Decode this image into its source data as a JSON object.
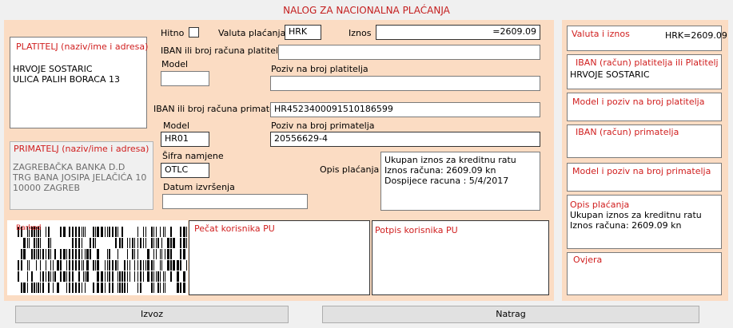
{
  "form_title": "NALOG ZA NACIONALNA PLAĆANJA",
  "platitelj": {
    "label": "PLATITELJ (naziv/ime i adresa)",
    "value": "HRVOJE SOSTARIC\nULICA PALIH BORACA 13"
  },
  "primatelj": {
    "label": "PRIMATELJ (naziv/ime i adresa)",
    "value": "ZAGREBAČKA BANKA D.D\nTRG BANA JOSIPA JELAČIĆA 10\n10000 ZAGREB"
  },
  "hitno_label": "Hitno",
  "hitno_checked": false,
  "valuta_label": "Valuta plaćanja",
  "valuta_value": "HRK",
  "iznos_label": "Iznos",
  "iznos_value": "=2609.09",
  "iban_platitelja_label": "IBAN ili broj računa platitelja",
  "iban_platitelja_value": "",
  "model_platitelja_label": "Model",
  "model_platitelja_value": "",
  "poziv_platitelja_label": "Poziv na broj platitelja",
  "poziv_platitelja_value": "",
  "iban_primatelja_label": "IBAN ili broj računa primatelja",
  "iban_primatelja_value": "HR4523400091510186599",
  "model_primatelja_label": "Model",
  "model_primatelja_value": "HR01",
  "poziv_primatelja_label": "Poziv na broj primatelja",
  "poziv_primatelja_value": "20556629-4",
  "sifra_label": "Šifra namjene",
  "sifra_value": "OTLC",
  "opis_label": "Opis plaćanja",
  "opis_value": "Ukupan iznos za kreditnu ratu\nIznos računa: 2609.09 kn\nDospijece racuna : 5/4/2017",
  "datum_label": "Datum izvršenja",
  "datum_value": "",
  "barcode_label": "Barkod",
  "pecat_label": "Pečat korisnika PU",
  "potpis_label": "Potpis korisnika PU",
  "summary": {
    "valuta_label": "Valuta i iznos",
    "valuta_value": "HRK=2609.09",
    "iban_platitelja_label": "IBAN (račun) platitelja ili Platitelj",
    "iban_platitelja_value": "HRVOJE SOSTARIC",
    "model_platitelja_label": "Model i poziv na broj platitelja",
    "iban_primatelja_label": "IBAN (račun) primatelja",
    "model_primatelja_label": "Model i poziv na broj primatelja",
    "opis_label": "Opis plaćanja",
    "opis_value": "Ukupan iznos za kreditnu ratu\nIznos računa: 2609.09 kn",
    "ovjera_label": "Ovjera"
  },
  "buttons": {
    "izvoz": "Izvoz",
    "natrag": "Natrag"
  }
}
